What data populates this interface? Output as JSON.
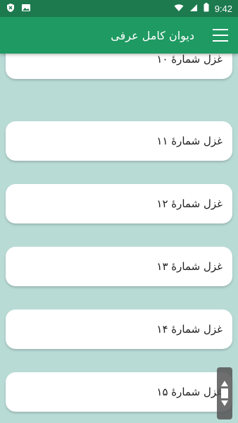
{
  "status_bar": {
    "time": "9:42",
    "icons": [
      "shield-x-icon",
      "image-icon",
      "wifi-icon",
      "cellular-icon",
      "battery-icon"
    ]
  },
  "app_bar": {
    "title": "دیوان کامل عرفی",
    "menu_icon": "hamburger-menu-icon"
  },
  "list": {
    "items": [
      {
        "label": "غزل شمارهٔ ۱۰"
      },
      {
        "label": "غزل شمارهٔ ۱۱"
      },
      {
        "label": "غزل شمارهٔ ۱۲"
      },
      {
        "label": "غزل شمارهٔ ۱۳"
      },
      {
        "label": "غزل شمارهٔ ۱۴"
      },
      {
        "label": "غزل شمارهٔ ۱۵"
      }
    ]
  },
  "colors": {
    "app_bar": "#1f9a62",
    "status_bar": "#1c7a4e",
    "background": "#b9dbd6",
    "card": "#ffffff"
  }
}
